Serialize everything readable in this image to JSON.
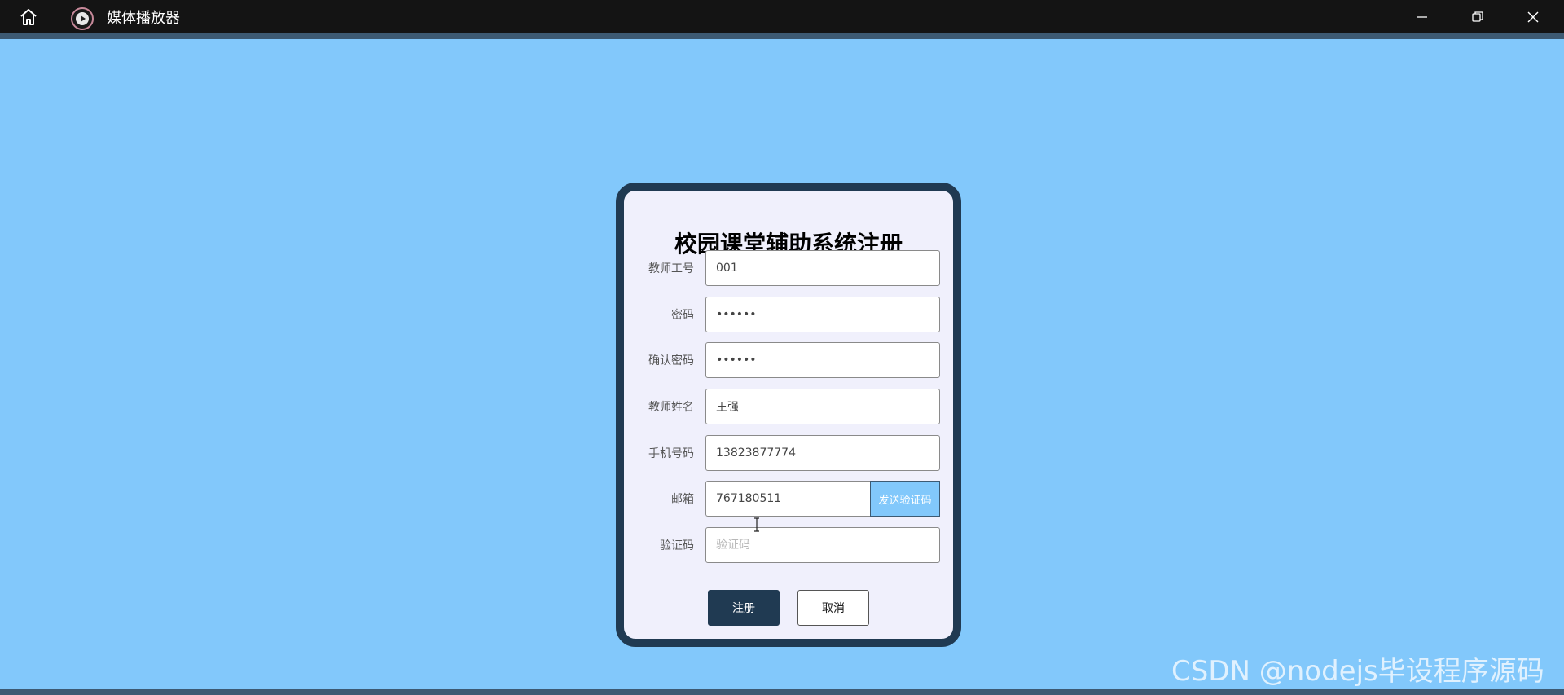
{
  "window": {
    "title": "媒体播放器"
  },
  "form": {
    "title": "校园课堂辅助系统注册",
    "fields": [
      {
        "label": "教师工号",
        "value": "001",
        "type": "text"
      },
      {
        "label": "密码",
        "value": "••••••",
        "type": "password"
      },
      {
        "label": "确认密码",
        "value": "••••••",
        "type": "password"
      },
      {
        "label": "教师姓名",
        "value": "王强",
        "type": "text"
      },
      {
        "label": "手机号码",
        "value": "13823877774",
        "type": "text"
      },
      {
        "label": "邮箱",
        "value": "767180511",
        "type": "text"
      },
      {
        "label": "验证码",
        "value": "",
        "placeholder": "验证码",
        "type": "text"
      }
    ],
    "send_code_label": "发送验证码",
    "register_label": "注册",
    "cancel_label": "取消"
  },
  "watermark": "CSDN @nodejs毕设程序源码",
  "colors": {
    "background": "#82c8fb",
    "card_border": "#203a52",
    "card_bg": "#f0f0fc",
    "primary_button": "#203a52",
    "send_button": "#82c8fb"
  },
  "icons": {
    "home": "home-icon",
    "app": "play-icon",
    "minimize": "minimize-icon",
    "maximize": "restore-icon",
    "close": "close-icon"
  }
}
